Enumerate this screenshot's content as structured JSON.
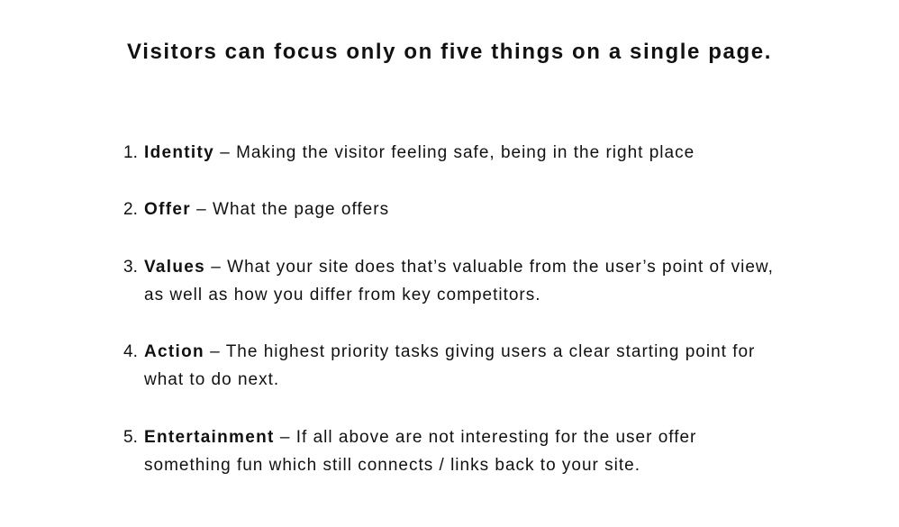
{
  "title": "Visitors can focus only on five things on a single page.",
  "items": [
    {
      "num": "1.",
      "term": "Identity",
      "desc": " – Making the visitor feeling safe, being in the right place"
    },
    {
      "num": "2.",
      "term": "Offer",
      "desc": " – What the page offers"
    },
    {
      "num": "3.",
      "term": "Values",
      "desc": " – What your site does that’s valuable from the user’s point of view, as well as how you differ from key competitors."
    },
    {
      "num": "4.",
      "term": "Action",
      "desc": " – The highest priority tasks giving users a clear starting point for what to do next."
    },
    {
      "num": "5.",
      "term": "Entertainment",
      "desc": " – If all above are not interesting for the user offer something fun which still connects / links back to your site."
    }
  ]
}
